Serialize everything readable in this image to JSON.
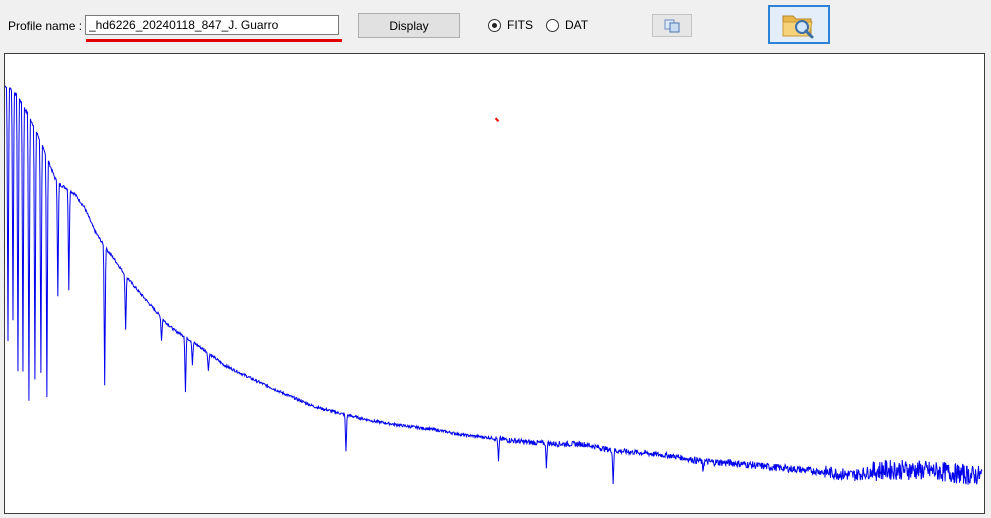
{
  "toolbar": {
    "profile_label": "Profile name :",
    "profile_value": "_hd6226_20240118_847_J. Guarro",
    "display_label": "Display",
    "format_options": [
      {
        "label": "FITS",
        "checked": true
      },
      {
        "label": "DAT",
        "checked": false
      }
    ],
    "copy_icon": "copy-icon",
    "open_icon": "folder-search-icon",
    "accent_color": "#e00000",
    "focus_color": "#2c82d6"
  },
  "plot": {
    "line_color": "#0000ee",
    "marker_color": "#ff0000"
  },
  "chart_data": {
    "type": "line",
    "title": "",
    "xlabel": "",
    "ylabel": "",
    "grid": false,
    "series": [
      {
        "x": [
          0,
          5,
          10,
          15,
          20,
          25,
          30,
          35,
          40,
          45,
          50,
          55,
          60,
          65,
          70,
          80,
          90,
          100,
          110,
          120,
          130,
          140,
          150,
          160,
          170,
          180,
          200,
          220,
          250,
          280,
          310,
          340,
          370,
          400,
          430,
          460,
          490,
          520,
          550,
          580,
          610,
          640,
          670,
          700,
          730,
          760,
          790,
          820,
          850,
          880,
          910,
          940,
          970,
          980
        ],
        "y": [
          0.93,
          0.925,
          0.915,
          0.9,
          0.88,
          0.86,
          0.838,
          0.812,
          0.785,
          0.758,
          0.73,
          0.715,
          0.71,
          0.702,
          0.695,
          0.665,
          0.615,
          0.58,
          0.552,
          0.52,
          0.493,
          0.468,
          0.443,
          0.418,
          0.398,
          0.385,
          0.355,
          0.322,
          0.29,
          0.26,
          0.232,
          0.215,
          0.2,
          0.19,
          0.182,
          0.17,
          0.163,
          0.155,
          0.151,
          0.15,
          0.136,
          0.131,
          0.124,
          0.112,
          0.109,
          0.102,
          0.096,
          0.09,
          0.082,
          0.094,
          0.094,
          0.09,
          0.082,
          0.082
        ]
      }
    ],
    "absorption_lines": [
      {
        "x": 3,
        "depth": 0.55
      },
      {
        "x": 8,
        "depth": 0.5
      },
      {
        "x": 13,
        "depth": 0.6
      },
      {
        "x": 18,
        "depth": 0.58
      },
      {
        "x": 24,
        "depth": 0.62
      },
      {
        "x": 30,
        "depth": 0.55
      },
      {
        "x": 36,
        "depth": 0.5
      },
      {
        "x": 42,
        "depth": 0.52
      },
      {
        "x": 53,
        "depth": 0.25
      },
      {
        "x": 64,
        "depth": 0.22
      },
      {
        "x": 100,
        "depth": 0.3
      },
      {
        "x": 121,
        "depth": 0.12
      },
      {
        "x": 157,
        "depth": 0.05
      },
      {
        "x": 181,
        "depth": 0.12
      },
      {
        "x": 188,
        "depth": 0.05
      },
      {
        "x": 204,
        "depth": 0.04
      },
      {
        "x": 342,
        "depth": 0.08
      },
      {
        "x": 495,
        "depth": 0.05
      },
      {
        "x": 543,
        "depth": 0.05
      },
      {
        "x": 610,
        "depth": 0.07
      },
      {
        "x": 700,
        "depth": 0.02
      }
    ],
    "marker": {
      "x": 492,
      "y": 0.86
    }
  }
}
